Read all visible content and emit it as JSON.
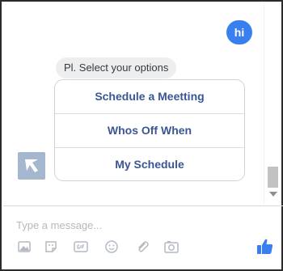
{
  "conversation": {
    "user_message": "hi",
    "bot_prompt": "Pl. Select your options",
    "options": [
      {
        "label": "Schedule a Meetting"
      },
      {
        "label": "Whos Off When"
      },
      {
        "label": "My Schedule"
      }
    ]
  },
  "composer": {
    "placeholder": "Type a message...",
    "tools": [
      "photo-icon",
      "sticker-icon",
      "gif-icon",
      "emoji-icon",
      "attachment-icon",
      "camera-icon"
    ]
  },
  "colors": {
    "accent": "#3a7ff0",
    "option_text": "#3a5693",
    "icon_gray": "#b3bac4"
  }
}
